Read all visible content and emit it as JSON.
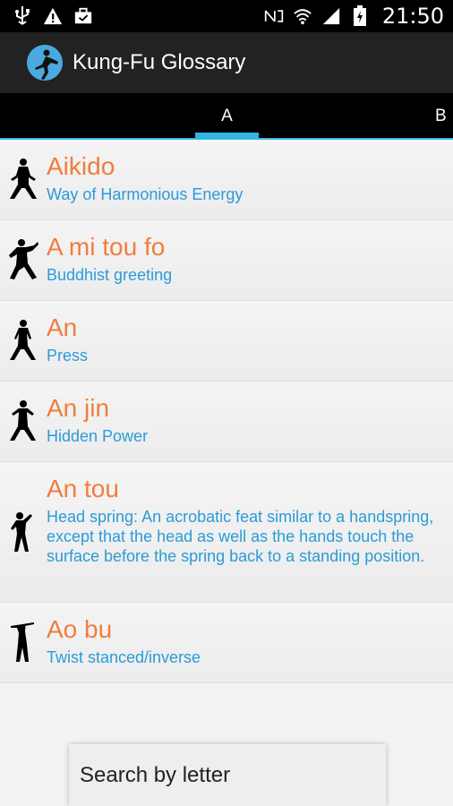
{
  "status_bar": {
    "time": "21:50",
    "left_icons": [
      "usb-icon",
      "warning-icon",
      "briefcase-icon"
    ],
    "right_icons": [
      "nfc-icon",
      "wifi-icon",
      "signal-icon",
      "battery-icon"
    ]
  },
  "action_bar": {
    "title": "Kung-Fu Glossary"
  },
  "tabs": [
    {
      "label": "A",
      "selected": true
    },
    {
      "label": "B",
      "selected": false
    }
  ],
  "entries": [
    {
      "term": "Aikido",
      "definition": "Way of Harmonious Energy"
    },
    {
      "term": "A mi tou fo",
      "definition": "Buddhist greeting"
    },
    {
      "term": "An",
      "definition": "Press"
    },
    {
      "term": "An jin",
      "definition": "Hidden Power"
    },
    {
      "term": "An tou",
      "definition": "Head spring: An acrobatic feat similar to a handspring, except that the head as well as the hands touch the surface before the spring back to a standing position."
    },
    {
      "term": "Ao bu",
      "definition": "Twist stanced/inverse"
    }
  ],
  "search": {
    "label": "Search by letter"
  },
  "colors": {
    "accent": "#33b5e5",
    "term": "#f27c3c",
    "definition": "#2a9bd8",
    "action_bar": "#222222"
  }
}
